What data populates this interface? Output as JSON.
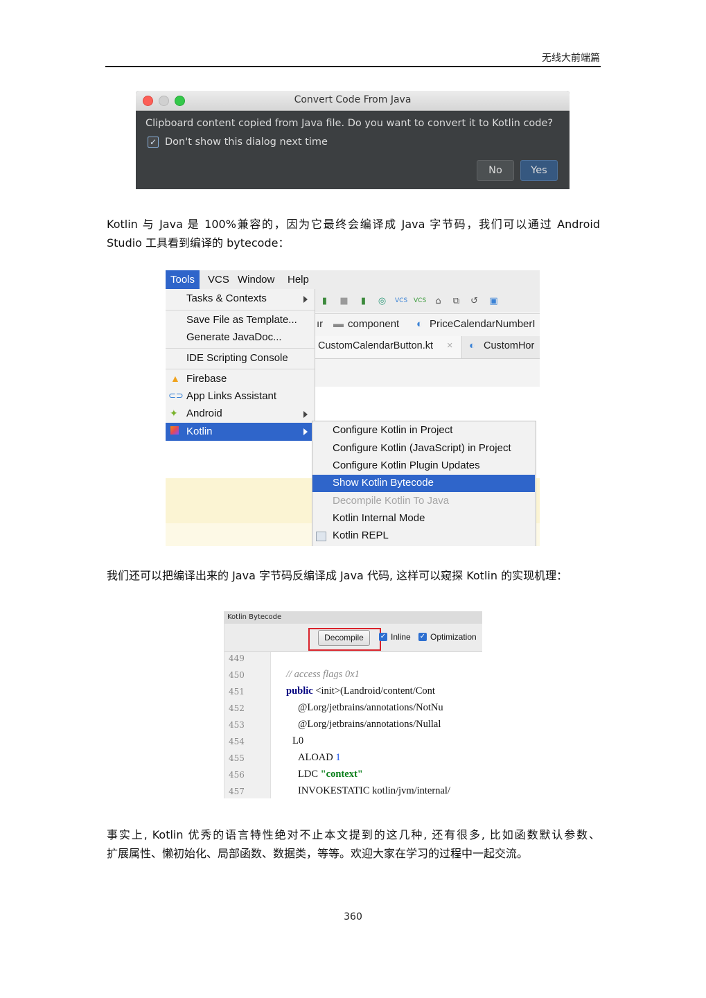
{
  "header": {
    "title": "无线大前端篇"
  },
  "dialog": {
    "title": "Convert Code From Java",
    "message": "Clipboard content copied from Java file. Do you want to convert it to Kotlin code?",
    "checkbox_label": "Don't show this dialog next time",
    "no_label": "No",
    "yes_label": "Yes"
  },
  "paragraphs": {
    "p1_line1": "Kotlin 与 Java 是 100%兼容的，因为它最终会编译成 Java 字节码，我们可以通过 Android",
    "p1_line2": "Studio 工具看到编译的 bytecode：",
    "p2": "我们还可以把编译出来的 Java 字节码反编译成 Java 代码, 这样可以窥探 Kotlin 的实现机理：",
    "p3_line1": "事实上, Kotlin 优秀的语言特性绝对不止本文提到的这几种, 还有很多, 比如函数默认参数、",
    "p3_line2": "扩展属性、懒初始化、局部函数、数据类，等等。欢迎大家在学习的过程中一起交流。"
  },
  "ide": {
    "menubar": [
      "Tools",
      "VCS",
      "Window",
      "Help"
    ],
    "tools_menu": [
      "Tasks & Contexts",
      "Save File as Template...",
      "Generate JavaDoc...",
      "IDE Scripting Console",
      "Firebase",
      "App Links Assistant",
      "Android",
      "Kotlin"
    ],
    "breadcrumb": [
      "ır",
      "component",
      "PriceCalendarNumberI"
    ],
    "tabs": [
      "CustomCalendarButton.kt",
      "CustomHor"
    ],
    "kotlin_submenu": [
      "Configure Kotlin in Project",
      "Configure Kotlin (JavaScript) in Project",
      "Configure Kotlin Plugin Updates",
      "Show Kotlin Bytecode",
      "Decompile Kotlin To Java",
      "Kotlin Internal Mode",
      "Kotlin REPL"
    ]
  },
  "bytecode": {
    "panel_title": "Kotlin Bytecode",
    "decompile_label": "Decompile",
    "inline_label": "Inline",
    "optimization_label": "Optimization",
    "line_numbers": [
      "449",
      "450",
      "451",
      "452",
      "453",
      "454",
      "455",
      "456",
      "457"
    ],
    "lines": {
      "l450": "// access flags 0x1",
      "l451_kw": "public",
      "l451_rest": " <init>(Landroid/content/Cont",
      "l452": "@Lorg/jetbrains/annotations/NotNu",
      "l453": "@Lorg/jetbrains/annotations/Nullal",
      "l454": "L0",
      "l455_a": "ALOAD ",
      "l455_b": "1",
      "l456_a": "LDC ",
      "l456_b": "\"context\"",
      "l457": "INVOKESTATIC kotlin/jvm/internal/"
    }
  },
  "page_number": "360",
  "colors": {
    "menu_selection": "#2f65ca",
    "submenu_selection": "#2f65ca",
    "dialog_bg": "#3c3f41",
    "decompile_highlight": "#d9232b"
  }
}
